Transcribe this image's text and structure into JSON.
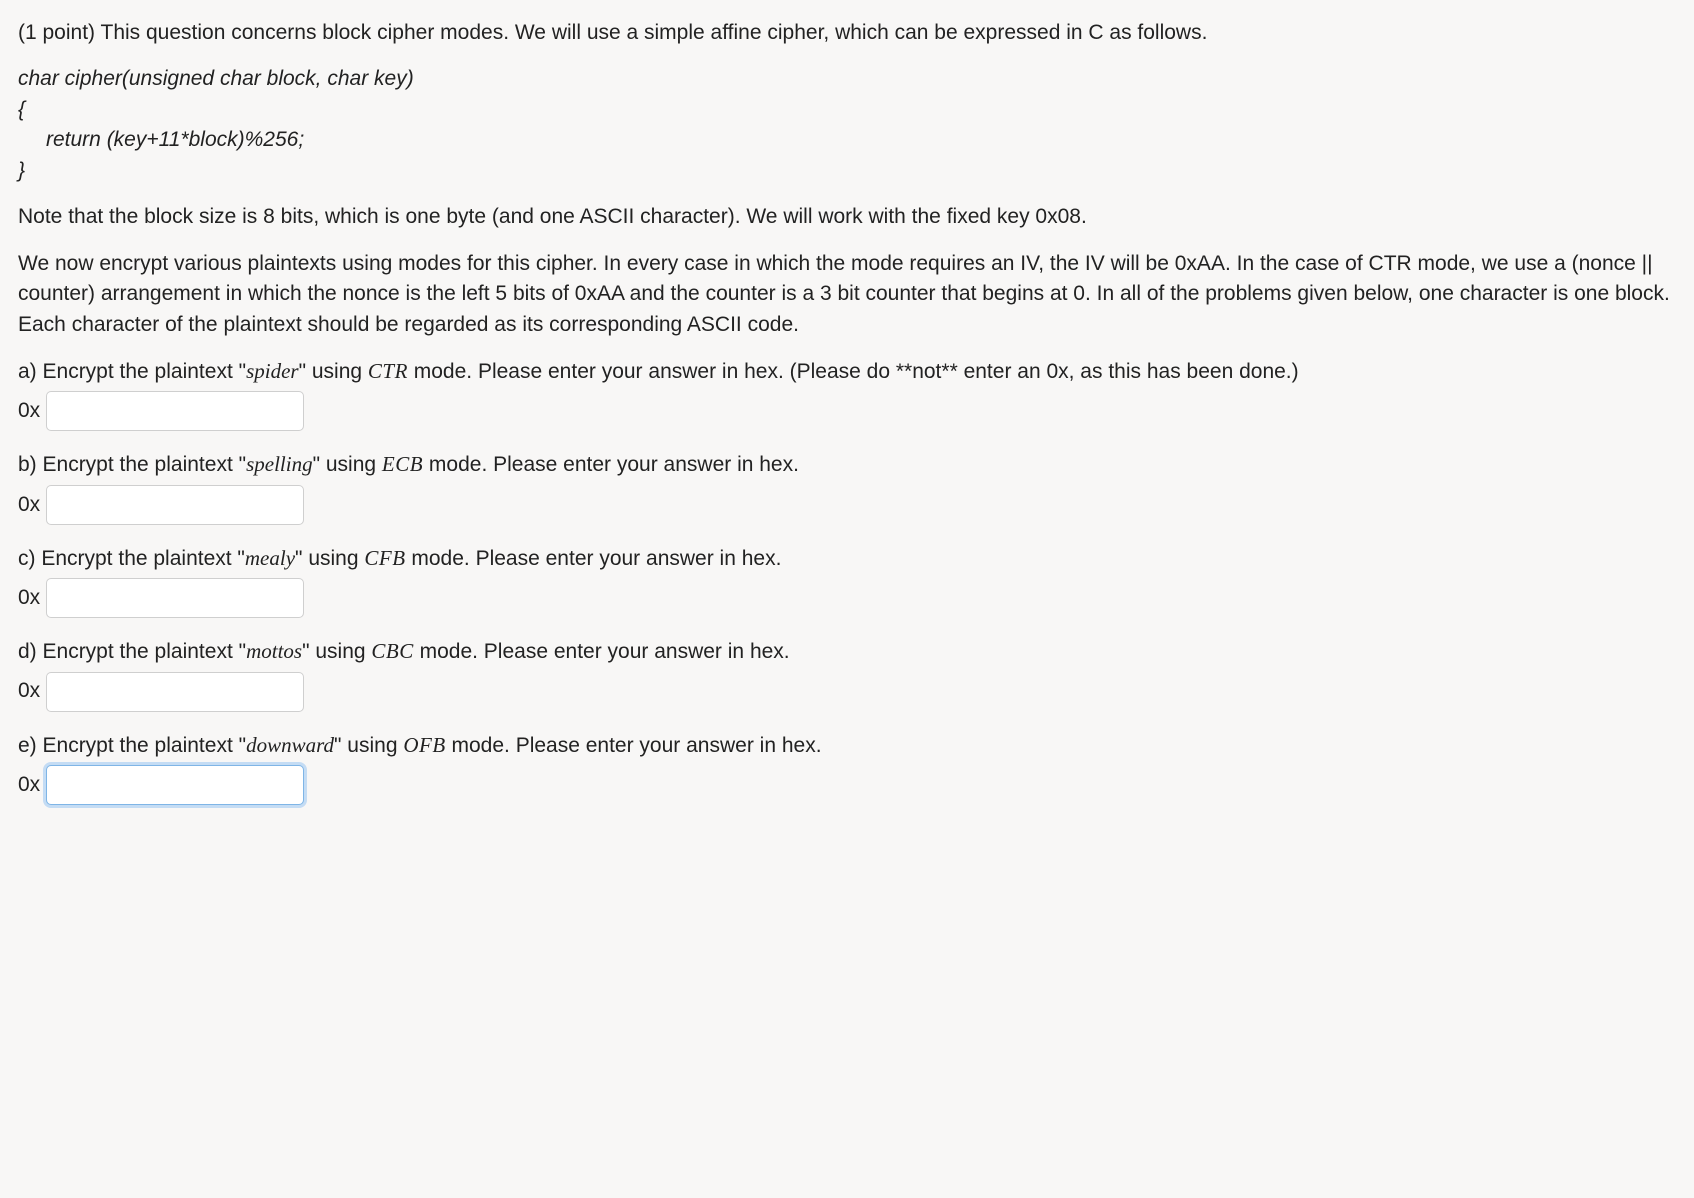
{
  "question": {
    "intro": "(1 point) This question concerns block cipher modes. We will use a simple affine cipher, which can be expressed in C as follows.",
    "code": {
      "line1": "char cipher(unsigned char block, char key)",
      "line2": "{",
      "line3": "return (key+11*block)%256;",
      "line4": "}"
    },
    "note": "Note that the block size is 8 bits, which is one byte (and one ASCII character). We will work with the fixed key 0x08.",
    "setup": "We now encrypt various plaintexts using modes for this cipher. In every case in which the mode requires an IV, the IV will be 0xAA. In the case of CTR mode, we use a (nonce || counter) arrangement in which the nonce is the left 5 bits of 0xAA and the counter is a 3 bit counter that begins at 0. In all of the problems given below, one character is one block. Each character of the plaintext should be regarded as its corresponding ASCII code.",
    "prefix": "0x",
    "parts": {
      "a": {
        "pre": "a) Encrypt the plaintext \"",
        "plaintext": "spider",
        "mid": "\" using ",
        "mode": "CTR",
        "post": " mode. Please enter your answer in hex. (Please do **not** enter an 0x, as this has been done.)"
      },
      "b": {
        "pre": "b) Encrypt the plaintext \"",
        "plaintext": "spelling",
        "mid": "\" using ",
        "mode": "ECB",
        "post": " mode. Please enter your answer in hex."
      },
      "c": {
        "pre": "c) Encrypt the plaintext \"",
        "plaintext": "mealy",
        "mid": "\" using ",
        "mode": "CFB",
        "post": " mode. Please enter your answer in hex."
      },
      "d": {
        "pre": "d) Encrypt the plaintext \"",
        "plaintext": "mottos",
        "mid": "\" using ",
        "mode": "CBC",
        "post": " mode. Please enter your answer in hex."
      },
      "e": {
        "pre": "e) Encrypt the plaintext \"",
        "plaintext": "downward",
        "mid": "\" using ",
        "mode": "OFB",
        "post": " mode. Please enter your answer in hex."
      }
    }
  }
}
